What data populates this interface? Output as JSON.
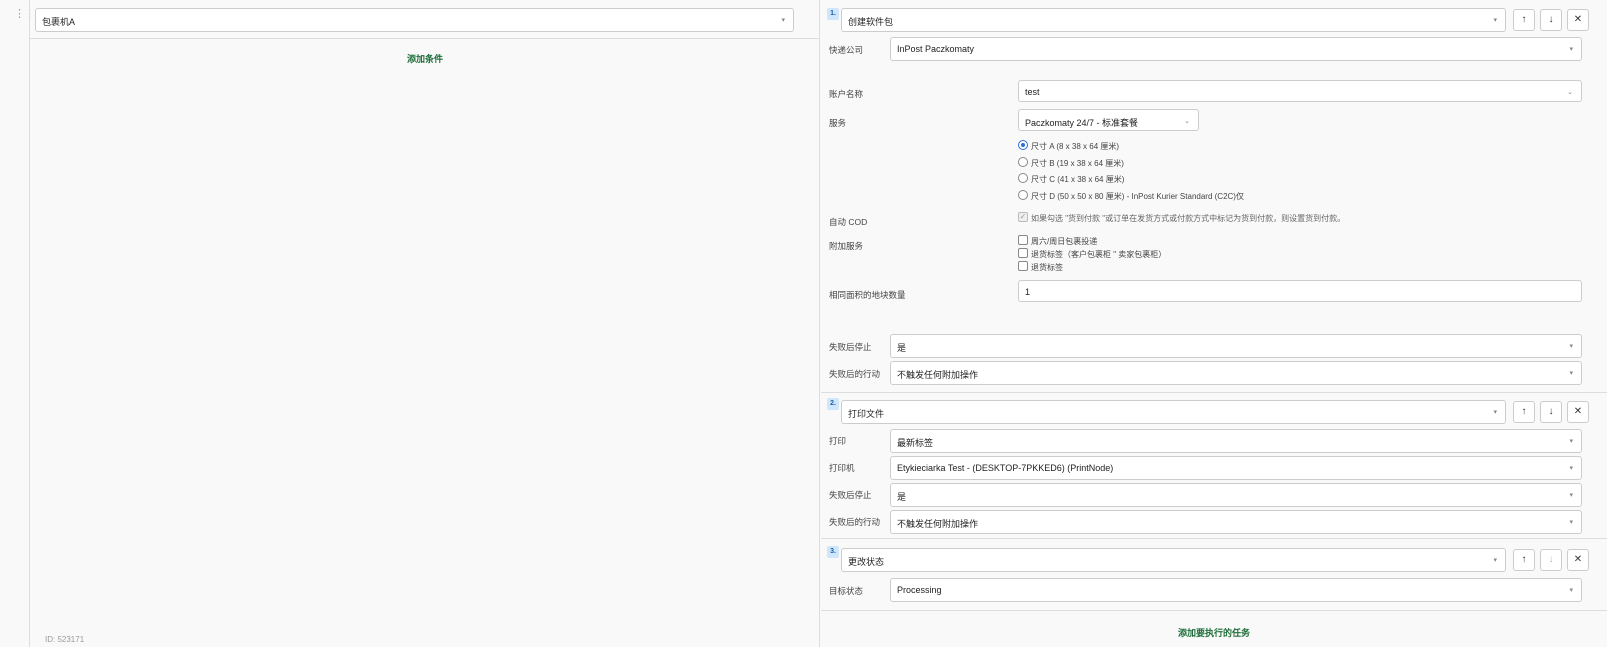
{
  "left": {
    "trigger_select": "包裹机A",
    "add_condition": "添加条件",
    "id_label": "ID: 523171"
  },
  "tasks": [
    {
      "number": "1.",
      "action": "创建软件包",
      "fields": {
        "courier_label": "快递公司",
        "courier_value": "InPost Paczkomaty",
        "account_label": "账户名称",
        "account_value": "test",
        "service_label": "服务",
        "service_value": "Paczkomaty 24/7 - 标准套餐",
        "sizes": [
          "尺寸 A (8 x 38 x 64 厘米)",
          "尺寸 B (19 x 38 x 64 厘米)",
          "尺寸 C (41 x 38 x 64 厘米)",
          "尺寸 D (50 x 50 x 80 厘米) - InPost Kurier Standard (C2C)仅"
        ],
        "selected_size": 0,
        "cod_label": "自动 COD",
        "cod_text": "如果勾选 \"货到付款 \"或订单在发货方式或付款方式中标记为货到付款，则设置货到付款。",
        "extra_label": "附加服务",
        "extras": [
          "周六/周日包裹投递",
          "退货标签（客户包裹柜 \" 卖家包裹柜）",
          "退货标签"
        ],
        "qty_label": "相同面积的地块数量",
        "qty_value": "1",
        "stop_label": "失败后停止",
        "stop_value": "是",
        "after_label": "失败后的行动",
        "after_value": "不触发任何附加操作"
      }
    },
    {
      "number": "2.",
      "action": "打印文件",
      "fields": {
        "print_label": "打印",
        "print_value": "最新标签",
        "printer_label": "打印机",
        "printer_value": "Etykieciarka Test - (DESKTOP-7PKKED6) (PrintNode)",
        "stop_label": "失败后停止",
        "stop_value": "是",
        "after_label": "失败后的行动",
        "after_value": "不触发任何附加操作"
      }
    },
    {
      "number": "3.",
      "action": "更改状态",
      "fields": {
        "status_label": "目标状态",
        "status_value": "Processing"
      }
    }
  ],
  "add_task": "添加要执行的任务",
  "icons": {
    "up": "arrow-up-icon",
    "down": "arrow-down-icon",
    "close": "close-icon",
    "caret": "caret-down-icon",
    "drag": "drag-handle-icon"
  }
}
